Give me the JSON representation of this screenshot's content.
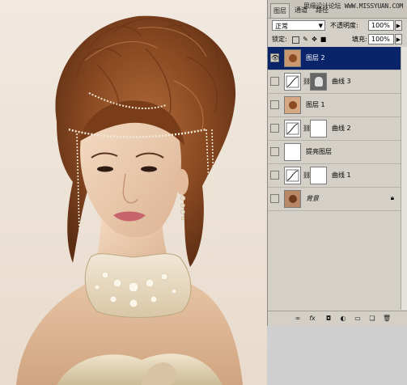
{
  "panel": {
    "tabs": [
      "图层",
      "通道",
      "路径"
    ],
    "watermark": "思缘设计论坛 WWW.MISSYUAN.COM",
    "blend_mode": "正常",
    "opacity_label": "不透明度:",
    "opacity_value": "100%",
    "lock_label": "锁定:",
    "fill_label": "填充:",
    "fill_value": "100%",
    "layers": [
      {
        "name": "图层 2",
        "selected": true,
        "visible": true
      },
      {
        "name": "曲线 3",
        "selected": false,
        "visible": false
      },
      {
        "name": "图层 1",
        "selected": false,
        "visible": false
      },
      {
        "name": "曲线 2",
        "selected": false,
        "visible": false
      },
      {
        "name": "提亮图层",
        "selected": false,
        "visible": false
      },
      {
        "name": "曲线 1",
        "selected": false,
        "visible": false
      },
      {
        "name": "背景",
        "selected": false,
        "visible": false
      }
    ]
  },
  "icons": {
    "eye": "eye-icon",
    "chain": "chain-link-icon",
    "lock": "lock-icon",
    "flyout": "triangle-right-icon",
    "footer": [
      "link-layers-icon",
      "fx-icon",
      "add-mask-icon",
      "adjustment-layer-icon",
      "new-group-icon",
      "new-layer-icon",
      "delete-icon"
    ]
  },
  "colors": {
    "selection": "#0a246a",
    "panel_bg": "#d4d0c8",
    "photo_bg": "#ede3d8"
  }
}
